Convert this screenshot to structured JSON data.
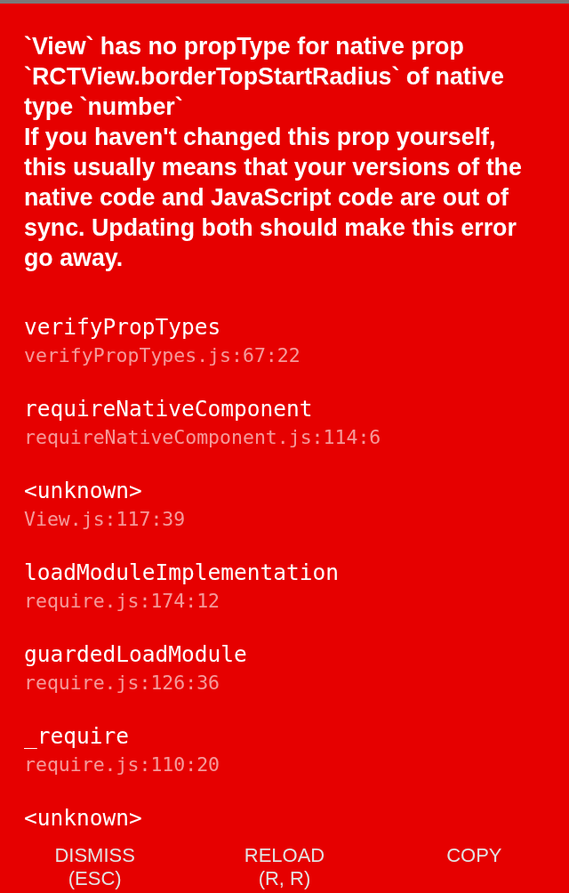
{
  "error": {
    "message": "`View` has no propType for native prop `RCTView.borderTopStartRadius` of native type `number`\nIf you haven't changed this prop yourself, this usually means that your versions of the native code and JavaScript code are out of sync. Updating both should make this error go away."
  },
  "stack": [
    {
      "method": "verifyPropTypes",
      "file": "verifyPropTypes.js:67:22"
    },
    {
      "method": "requireNativeComponent",
      "file": "requireNativeComponent.js:114:6"
    },
    {
      "method": "<unknown>",
      "file": "View.js:117:39"
    },
    {
      "method": "loadModuleImplementation",
      "file": "require.js:174:12"
    },
    {
      "method": "guardedLoadModule",
      "file": "require.js:126:36"
    },
    {
      "method": "_require",
      "file": "require.js:110:20"
    },
    {
      "method": "<unknown>"
    }
  ],
  "buttons": [
    {
      "label": "DISMISS\n(ESC)"
    },
    {
      "label": "RELOAD\n(R, R)"
    },
    {
      "label": "COPY"
    }
  ]
}
